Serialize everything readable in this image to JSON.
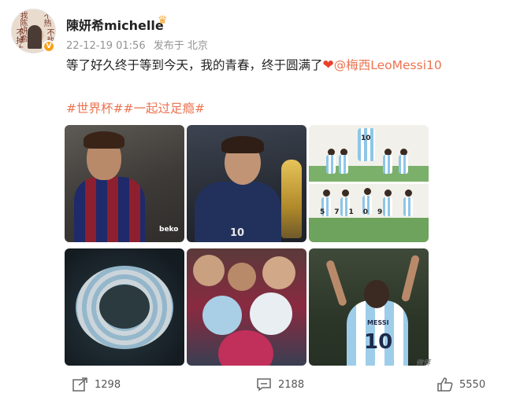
{
  "post": {
    "username": "陳妍希michelle",
    "timestamp": "22-12-19 01:56",
    "source": "发布于 北京",
    "text_before": "等了好久终于等到今天，我的青春，终于圆满了",
    "mention": "@梅西LeoMessi10",
    "tags": "#世界杯##一起过足瘾#",
    "avatar_text": [
      "我陈妍希",
      "不热",
      "不掉土",
      "不热"
    ],
    "crown_icon": "crown-icon",
    "verified_icon": "v-badge-icon"
  },
  "images": {
    "img1_text": "beko",
    "img2_number": "10",
    "img3_top_number": "10",
    "img3_numbers": "57109",
    "img6_name": "MESSI",
    "img6_number": "10",
    "watermark": "微博"
  },
  "actions": {
    "share_count": "1298",
    "comment_count": "2188",
    "like_count": "5550"
  },
  "colors": {
    "accent": "#eb7350",
    "heart": "#e8412b",
    "text": "#222222",
    "meta": "#939393"
  }
}
